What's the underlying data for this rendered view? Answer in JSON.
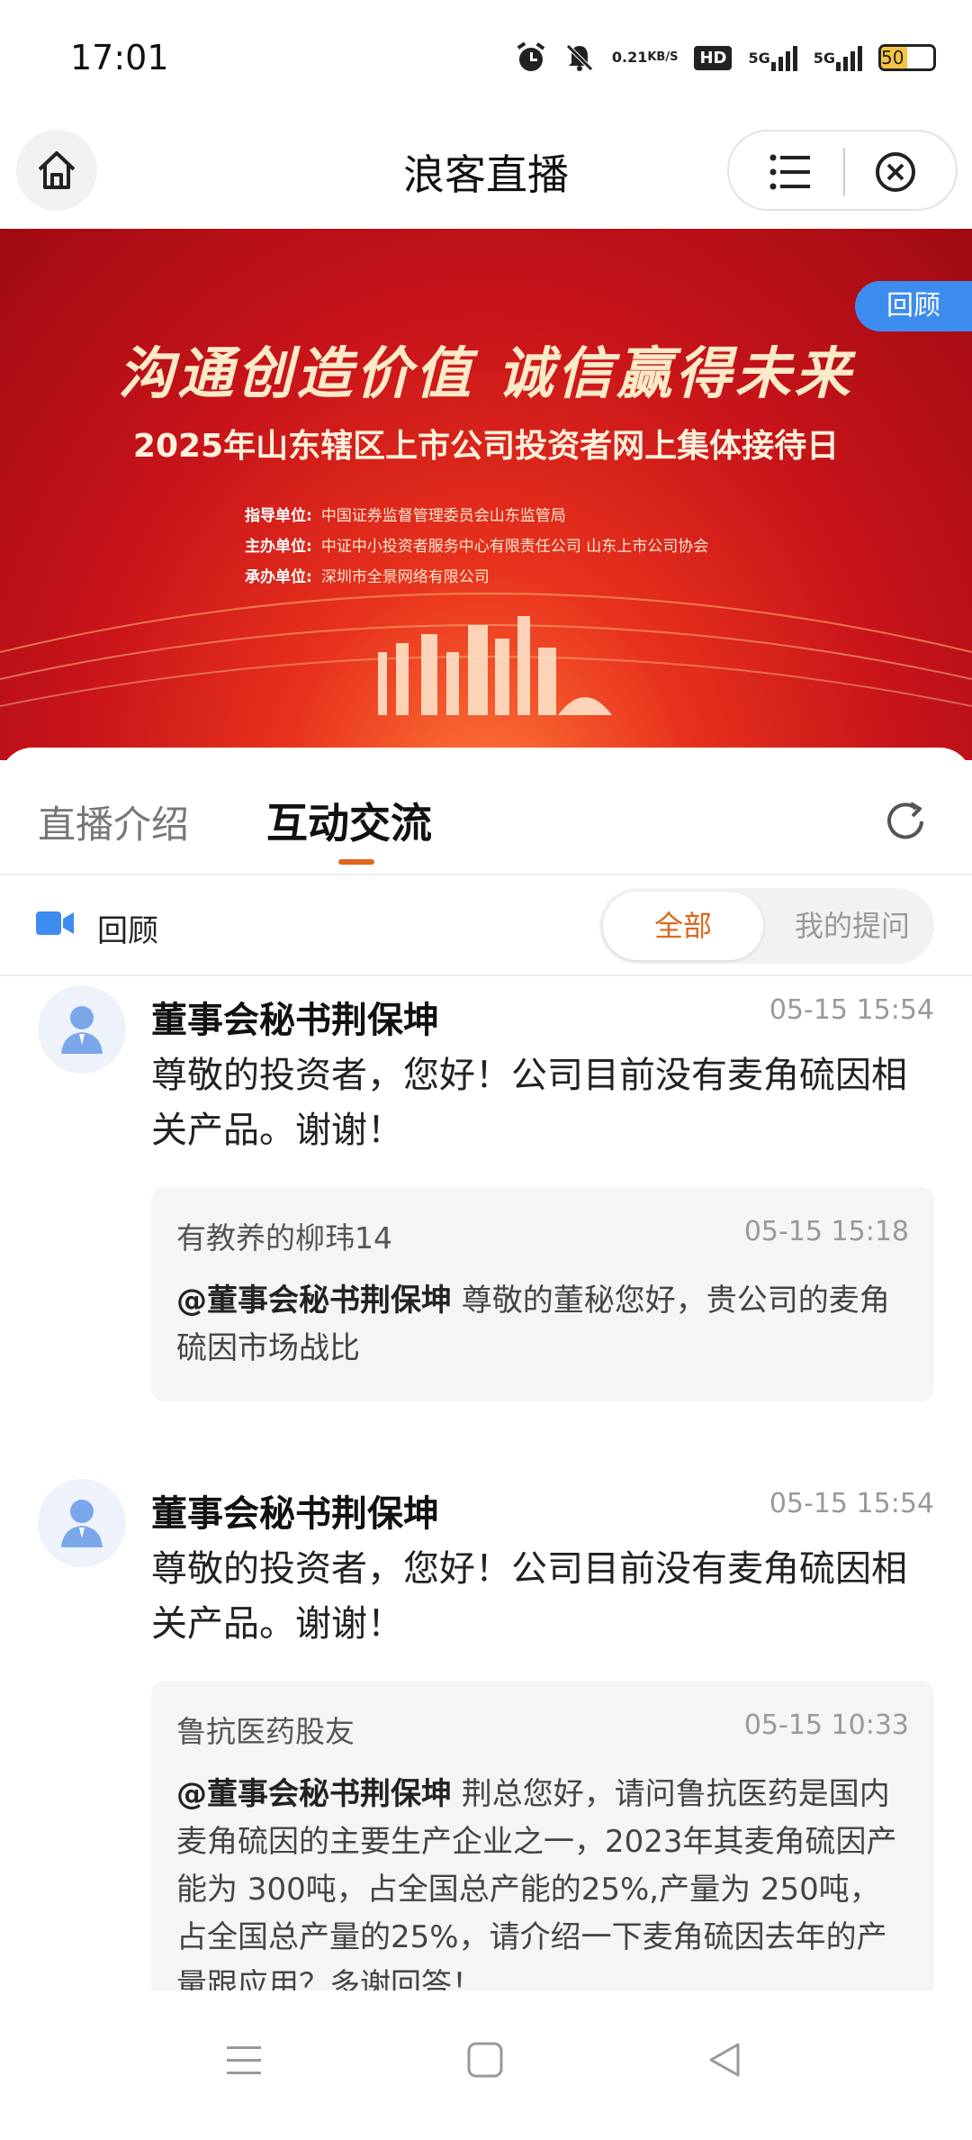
{
  "status_bar": {
    "time": "17:01",
    "speed_value": "0.21",
    "speed_unit": "KB/S",
    "hd_label": "HD",
    "sim1_label": "5G",
    "sim2_label": "5G",
    "battery_level": "50",
    "battery_fraction": 0.5
  },
  "header": {
    "title": "浪客直播",
    "icons": [
      "home-icon",
      "menu-list-icon",
      "close-circle-icon"
    ]
  },
  "banner": {
    "review_tag": "回顾",
    "slogan": "沟通创造价值  诚信赢得未来",
    "title": "2025年山东辖区上市公司投资者网上集体接待日",
    "org_rows": [
      {
        "label": "指导单位:",
        "value": "中国证券监督管理委员会山东监管局"
      },
      {
        "label": "主办单位:",
        "value": "中证中小投资者服务中心有限责任公司  山东上市公司协会"
      },
      {
        "label": "承办单位:",
        "value": "深圳市全景网络有限公司"
      }
    ]
  },
  "tabs": {
    "intro": "直播介绍",
    "interaction": "互动交流"
  },
  "filter": {
    "review_label": "回顾",
    "all_label": "全部",
    "mine_label": "我的提问"
  },
  "feed": [
    {
      "name": "董事会秘书荆保坤",
      "time": "05-15 15:54",
      "answer": "尊敬的投资者，您好！公司目前没有麦角硫因相关产品。谢谢！",
      "question_user": "有教养的柳玮14",
      "question_time": "05-15 15:18",
      "mention": "@董事会秘书荆保坤",
      "question": " 尊敬的董秘您好，贵公司的麦角硫因市场战比"
    },
    {
      "name": "董事会秘书荆保坤",
      "time": "05-15 15:54",
      "answer": "尊敬的投资者，您好！公司目前没有麦角硫因相关产品。谢谢！",
      "question_user": "鲁抗医药股友",
      "question_time": "05-15 10:33",
      "mention": "@董事会秘书荆保坤",
      "question": " 荆总您好，请问鲁抗医药是国内麦角硫因的主要生产企业之一，2023年其麦角硫因产能为 300吨，占全国总产能的25%,产量为 250吨，占全国总产量的25%，请介绍一下麦角硫因去年的产量跟应用？多谢回答！"
    }
  ],
  "nav": {
    "icons": [
      "recent-apps-icon",
      "home-square-icon",
      "back-triangle-icon"
    ]
  },
  "colors": {
    "accent": "#e0651c",
    "blue": "#3d8cf0",
    "banner_red": "#c8141a"
  }
}
